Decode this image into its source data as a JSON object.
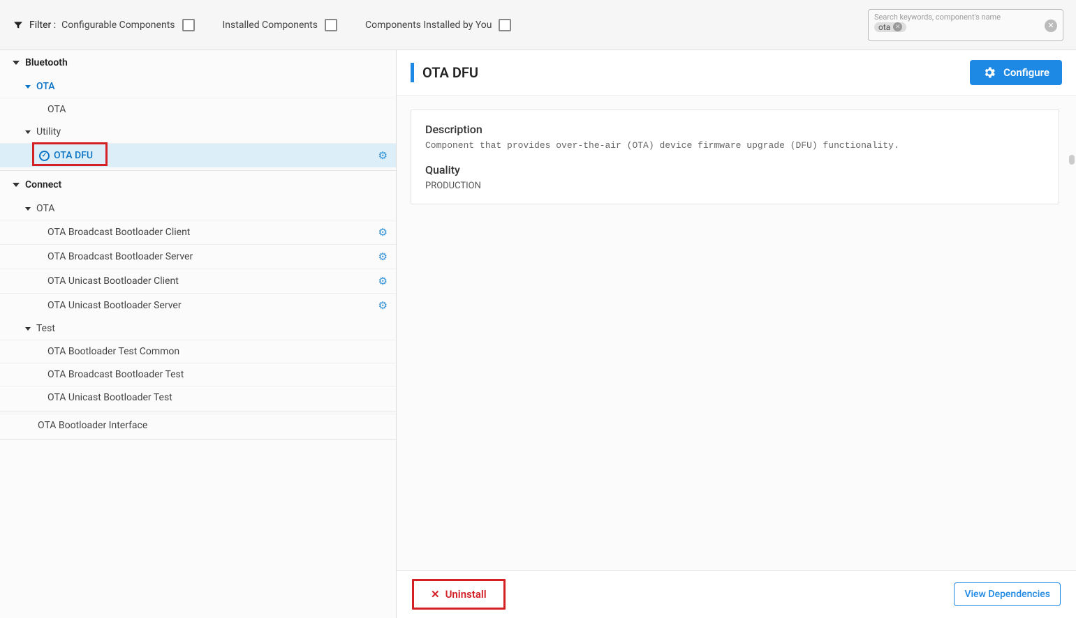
{
  "topbar": {
    "filter_label": "Filter :",
    "configurable_label": "Configurable Components",
    "installed_label": "Installed Components",
    "installed_by_you_label": "Components Installed by You",
    "search_placeholder": "Search keywords, component's name",
    "search_chip": "ota"
  },
  "tree": {
    "bluetooth": {
      "label": "Bluetooth",
      "ota_group": "OTA",
      "ota_item": "OTA",
      "utility_group": "Utility",
      "ota_dfu": "OTA DFU"
    },
    "connect": {
      "label": "Connect",
      "ota_group": "OTA",
      "items_ota": [
        "OTA Broadcast Bootloader Client",
        "OTA Broadcast Bootloader Server",
        "OTA Unicast Bootloader Client",
        "OTA Unicast Bootloader Server"
      ],
      "test_group": "Test",
      "items_test": [
        "OTA Bootloader Test Common",
        "OTA Broadcast Bootloader Test",
        "OTA Unicast Bootloader Test"
      ],
      "bootloader_interface": "OTA Bootloader Interface"
    }
  },
  "details": {
    "title": "OTA DFU",
    "configure_label": "Configure",
    "description_heading": "Description",
    "description_text": "Component that provides over-the-air (OTA) device firmware upgrade (DFU) functionality.",
    "quality_heading": "Quality",
    "quality_value": "PRODUCTION",
    "uninstall_label": "Uninstall",
    "view_deps_label": "View Dependencies"
  }
}
